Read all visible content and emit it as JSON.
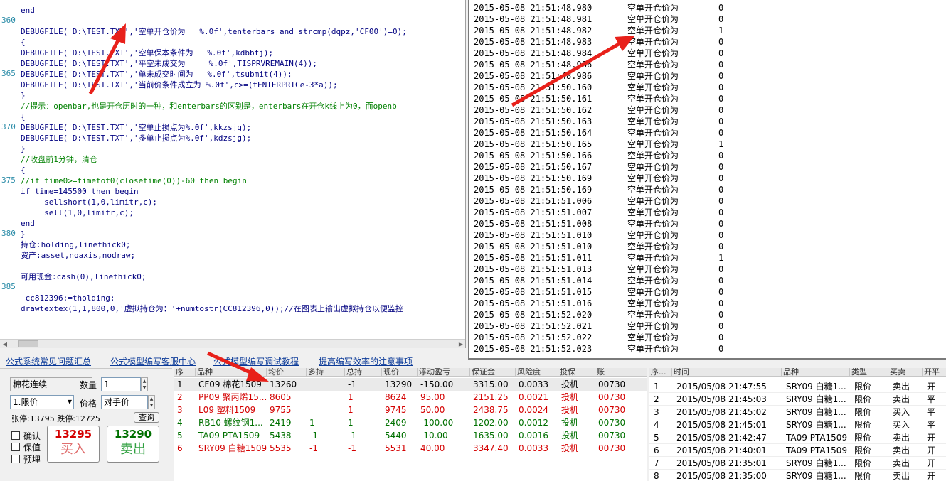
{
  "editor": {
    "line_numbers": [
      "360",
      "365",
      "370",
      "375",
      "380",
      "385"
    ],
    "lines": [
      "end",
      "",
      "DEBUGFILE('D:\\TEST.TXT','空单开仓价为   %.0f',tenterbars and strcmp(dqpz,'CF00')=0);",
      "{",
      "DEBUGFILE('D:\\TEST.TXT','空单保本条件为   %.0f',kdbbtj);",
      "DEBUGFILE('D:\\TEST.TXT','平空未成交为     %.0f',TISPRVREMAIN(4));",
      "DEBUGFILE('D:\\TEST.TXT','单未成交时间为   %.0f',tsubmit(4));",
      "DEBUGFILE('D:\\TEST.TXT','当前价条件成立为 %.0f',c>=(tENTERPRICe-3*a));",
      "}",
      "//提示：openbar,也是开仓历时的一种，和enterbars的区别是，enterbars在开仓k线上为0，而openb",
      "{",
      "DEBUGFILE('D:\\TEST.TXT','空单止损点为%.0f',kkzsjg);",
      "DEBUGFILE('D:\\TEST.TXT','多单止损点为%.0f',kdzsjg);",
      "}",
      "//收盘前1分钟，清仓",
      "{",
      "//if time0>=timetot0(closetime(0))-60 then begin",
      "if time=145500 then begin",
      "     sellshort(1,0,limitr,c);",
      "     sell(1,0,limitr,c);",
      "end",
      "}",
      "持仓:holding,linethick0;",
      "资产:asset,noaxis,nodraw;",
      "",
      "可用现金:cash(0),linethick0;",
      "",
      " cc812396:=tholding;",
      "drawtextex(1,1,800,0,'虚拟持仓为：'+numtostr(CC812396,0));//在图表上输出虚拟持仓以便监控"
    ]
  },
  "output": {
    "label": "空单开仓价为",
    "rows": [
      [
        "2015-05-08 21:51:48.980",
        "0"
      ],
      [
        "2015-05-08 21:51:48.981",
        "0"
      ],
      [
        "2015-05-08 21:51:48.982",
        "1"
      ],
      [
        "2015-05-08 21:51:48.983",
        "0"
      ],
      [
        "2015-05-08 21:51:48.984",
        "0"
      ],
      [
        "2015-05-08 21:51:48.986",
        "0"
      ],
      [
        "2015-05-08 21:51:48.986",
        "0"
      ],
      [
        "2015-05-08 21:51:50.160",
        "0"
      ],
      [
        "2015-05-08 21:51:50.161",
        "0"
      ],
      [
        "2015-05-08 21:51:50.162",
        "0"
      ],
      [
        "2015-05-08 21:51:50.163",
        "0"
      ],
      [
        "2015-05-08 21:51:50.164",
        "0"
      ],
      [
        "2015-05-08 21:51:50.165",
        "1"
      ],
      [
        "2015-05-08 21:51:50.166",
        "0"
      ],
      [
        "2015-05-08 21:51:50.167",
        "0"
      ],
      [
        "2015-05-08 21:51:50.169",
        "0"
      ],
      [
        "2015-05-08 21:51:50.169",
        "0"
      ],
      [
        "2015-05-08 21:51:51.006",
        "0"
      ],
      [
        "2015-05-08 21:51:51.007",
        "0"
      ],
      [
        "2015-05-08 21:51:51.008",
        "0"
      ],
      [
        "2015-05-08 21:51:51.010",
        "0"
      ],
      [
        "2015-05-08 21:51:51.010",
        "0"
      ],
      [
        "2015-05-08 21:51:51.011",
        "1"
      ],
      [
        "2015-05-08 21:51:51.013",
        "0"
      ],
      [
        "2015-05-08 21:51:51.014",
        "0"
      ],
      [
        "2015-05-08 21:51:51.015",
        "0"
      ],
      [
        "2015-05-08 21:51:51.016",
        "0"
      ],
      [
        "2015-05-08 21:51:52.020",
        "0"
      ],
      [
        "2015-05-08 21:51:52.021",
        "0"
      ],
      [
        "2015-05-08 21:51:52.022",
        "0"
      ],
      [
        "2015-05-08 21:51:52.023",
        "0"
      ]
    ]
  },
  "links": [
    "公式系统常见问题汇总",
    "公式模型编写客服中心",
    "公式模型编写调试教程",
    "提高编写效率的注意事项"
  ],
  "order": {
    "contract": "棉花连续",
    "qty_label": "数量",
    "qty": "1",
    "order_type": "1.限价",
    "price_label": "价格",
    "price_mode": "对手价",
    "limit_info": "张停:13795 跌停:12725",
    "query_btn": "查询",
    "chk_confirm": "确认",
    "chk_keep": "保值",
    "chk_preset": "预埋",
    "buy_price": "13295",
    "buy_label": "买入",
    "sell_price": "13290",
    "sell_label": "卖出"
  },
  "positions": {
    "headers": [
      "序",
      "品种",
      "均价",
      "多持",
      "总持",
      "现价",
      "浮动盈亏",
      "保证金",
      "风险度",
      "投保",
      "账"
    ],
    "rows": [
      [
        "1",
        "CF09 棉花1509",
        "13260",
        "",
        "-1",
        "13290",
        "-150.00",
        "3315.00",
        "0.0033",
        "投机",
        "00730"
      ],
      [
        "2",
        "PP09 聚丙烯15...",
        "8605",
        "",
        "1",
        "8624",
        "95.00",
        "2151.25",
        "0.0021",
        "投机",
        "00730"
      ],
      [
        "3",
        "L09 塑料1509",
        "9755",
        "",
        "1",
        "9745",
        "50.00",
        "2438.75",
        "0.0024",
        "投机",
        "00730"
      ],
      [
        "4",
        "RB10 螺纹钢1...",
        "2419",
        "1",
        "1",
        "2409",
        "-100.00",
        "1202.00",
        "0.0012",
        "投机",
        "00730"
      ],
      [
        "5",
        "TA09 PTA1509",
        "5438",
        "-1",
        "-1",
        "5440",
        "-10.00",
        "1635.00",
        "0.0016",
        "投机",
        "00730"
      ],
      [
        "6",
        "SRY09 白糖1509",
        "5535",
        "-1",
        "-1",
        "5531",
        "40.00",
        "3347.40",
        "0.0033",
        "投机",
        "00730"
      ]
    ],
    "row_colors": [
      "#000000",
      "#d40000",
      "#d40000",
      "#007000",
      "#007000",
      "#d40000"
    ]
  },
  "trades": {
    "headers": [
      "序...",
      "时间",
      "品种",
      "类型",
      "买卖",
      "开平"
    ],
    "rows": [
      [
        "1",
        "2015/05/08 21:47:55",
        "SRY09 白糖1...",
        "限价",
        "卖出",
        "开"
      ],
      [
        "2",
        "2015/05/08 21:45:03",
        "SRY09 白糖1...",
        "限价",
        "卖出",
        "平"
      ],
      [
        "3",
        "2015/05/08 21:45:02",
        "SRY09 白糖1...",
        "限价",
        "买入",
        "平"
      ],
      [
        "4",
        "2015/05/08 21:45:01",
        "SRY09 白糖1...",
        "限价",
        "买入",
        "平"
      ],
      [
        "5",
        "2015/05/08 21:42:47",
        "TA09 PTA1509",
        "限价",
        "卖出",
        "开"
      ],
      [
        "6",
        "2015/05/08 21:40:01",
        "TA09 PTA1509",
        "限价",
        "卖出",
        "开"
      ],
      [
        "7",
        "2015/05/08 21:35:01",
        "SRY09 白糖1...",
        "限价",
        "卖出",
        "开"
      ],
      [
        "8",
        "2015/05/08 21:35:00",
        "SRY09 白糖1...",
        "限价",
        "卖出",
        "开"
      ]
    ]
  },
  "colors": {
    "annotation_arrow": "#e8201a",
    "buy": "#d40000",
    "sell": "#007000",
    "code_text": "#000080",
    "comment_text": "#008000",
    "line_number": "#2b8ca8",
    "link": "#0b3a98"
  }
}
